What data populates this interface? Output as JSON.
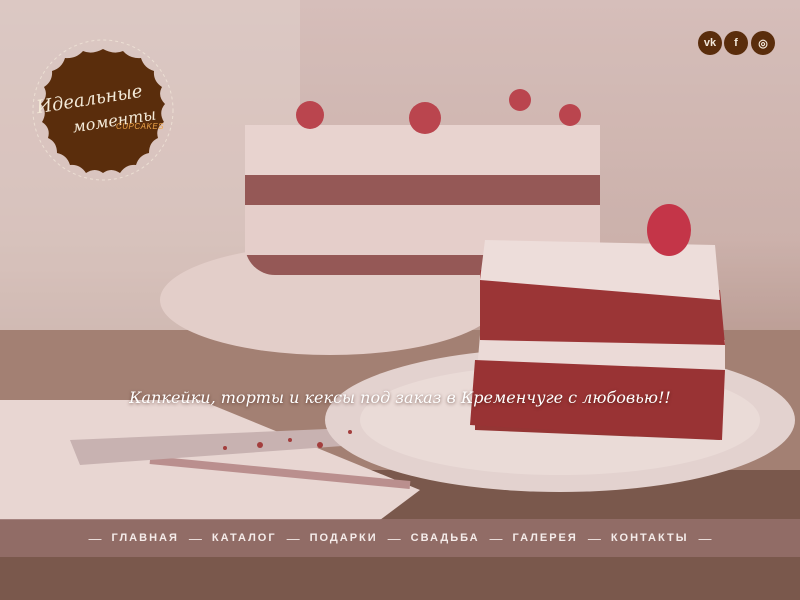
{
  "logo": {
    "line1": "Идеальные",
    "line2": "моменты",
    "sub": "CUPCAKES"
  },
  "social": {
    "vk": "vk",
    "fb": "f",
    "ig": "◎"
  },
  "tagline": "Капкейки, торты и кексы под заказ в Кременчуге с любовью!!",
  "nav": {
    "items": [
      "главная",
      "каталог",
      "подарки",
      "свадьба",
      "галерея",
      "контакты"
    ],
    "separator": "—"
  },
  "colors": {
    "logo_bg": "#5a2d0c",
    "nav_bg": "#96706c",
    "accent": "#f0a64a"
  },
  "icons": [
    "vk-icon",
    "facebook-icon",
    "instagram-icon"
  ]
}
